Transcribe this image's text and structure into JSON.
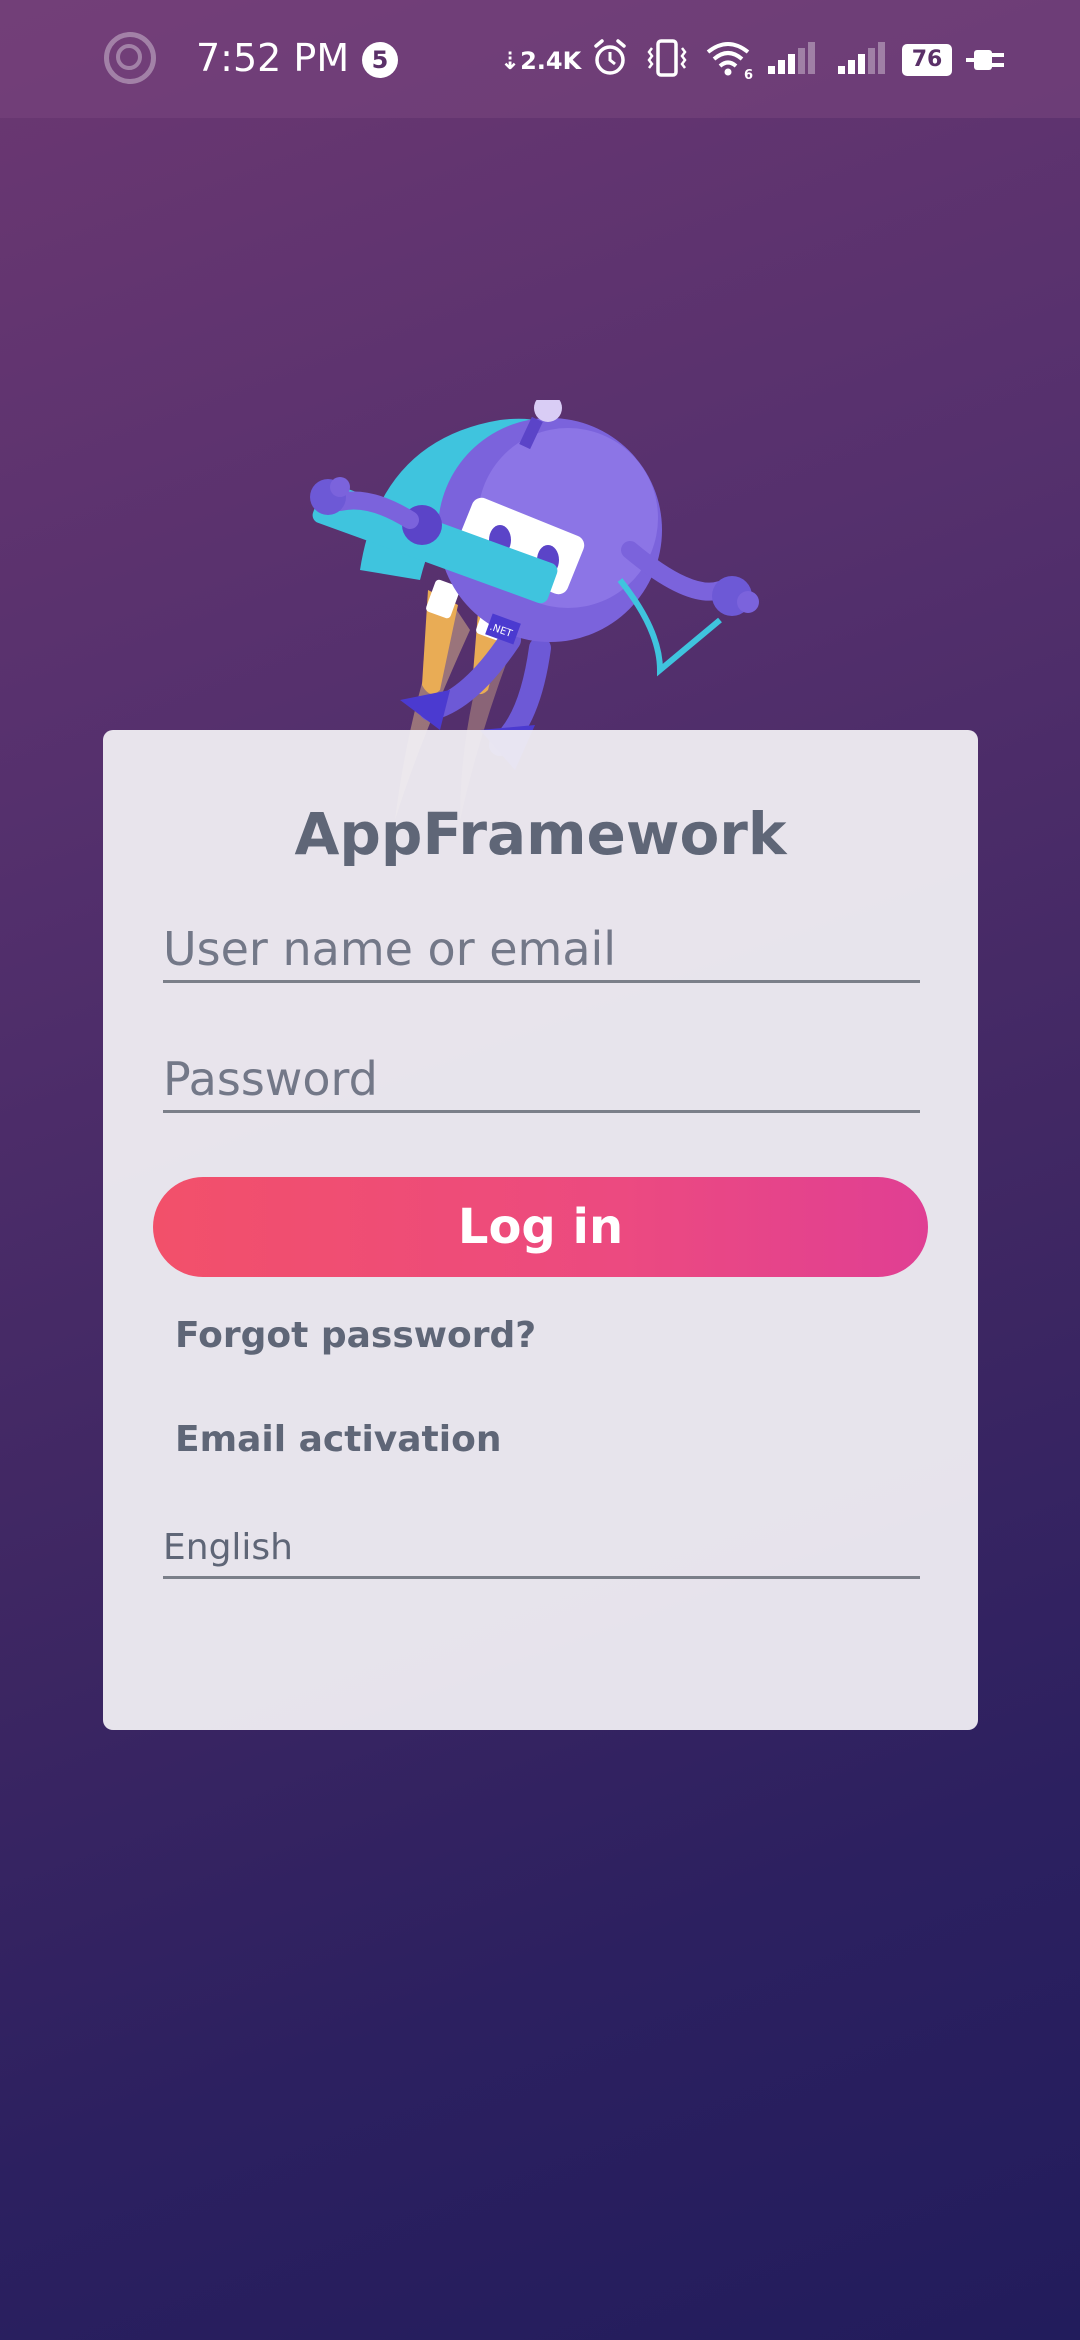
{
  "status_bar": {
    "time": "7:52 PM",
    "notification_count": "5",
    "net_speed": "⇣2.4K",
    "wifi_badge": "6",
    "battery_level": "76"
  },
  "login": {
    "app_title": "AppFramework",
    "username_placeholder": "User name or email",
    "password_placeholder": "Password",
    "login_button": "Log in",
    "forgot_password": "Forgot password?",
    "email_activation": "Email activation",
    "language": "English"
  },
  "mascot": {
    "badge_text": ".NET"
  },
  "colors": {
    "background_top": "#6c3872",
    "background_bottom": "#221c5c",
    "button_start": "#f2506a",
    "button_end": "#e03f93",
    "card": "#f0eef3",
    "text": "#5f6677"
  },
  "icons": [
    "record-icon",
    "download-icon",
    "alarm-icon",
    "vibrate-icon",
    "wifi-icon",
    "signal-icon",
    "battery-icon",
    "charging-icon"
  ]
}
